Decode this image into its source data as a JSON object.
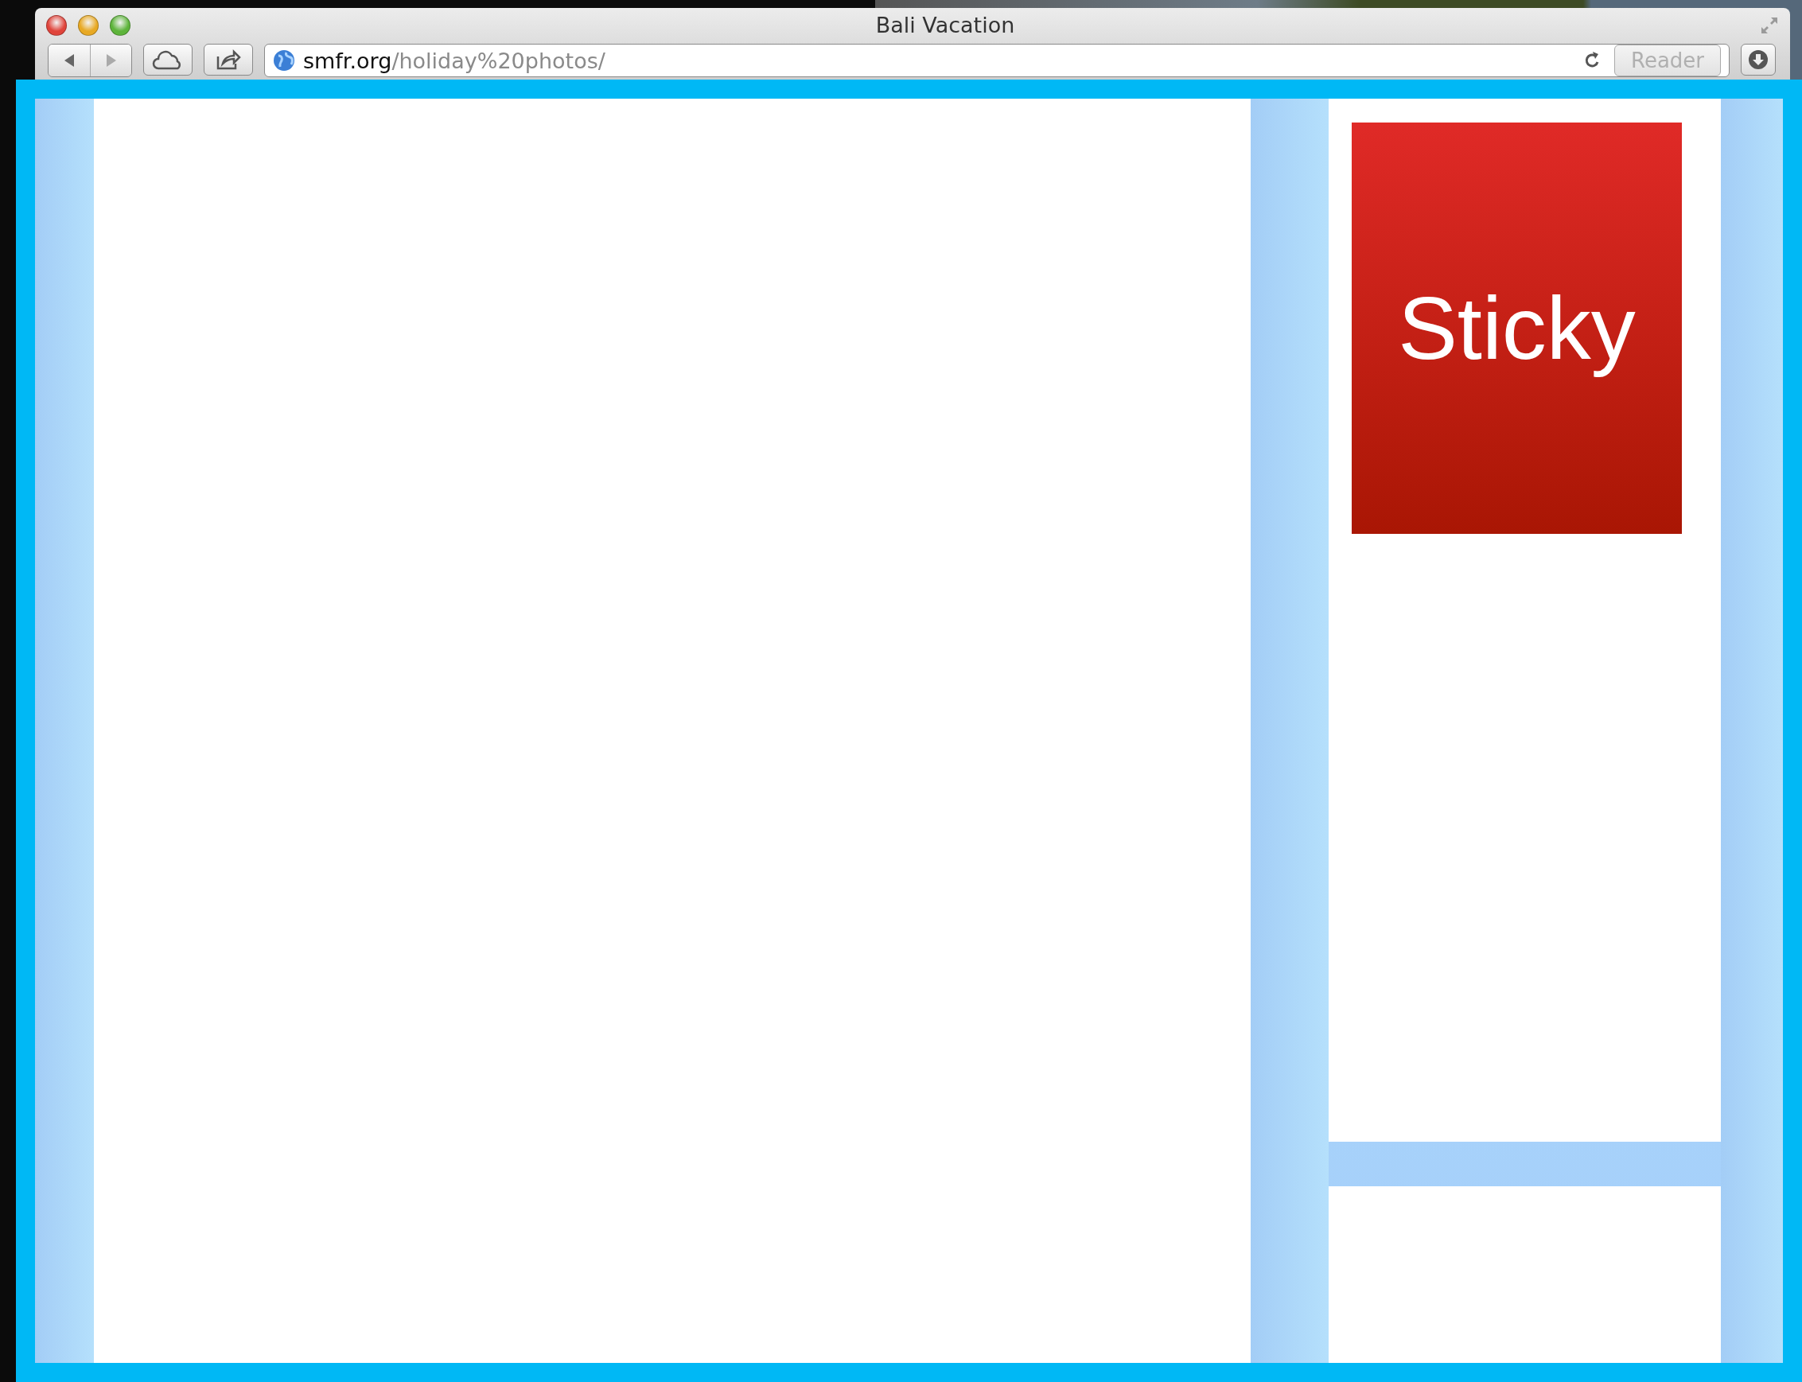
{
  "window": {
    "title": "Bali Vacation"
  },
  "toolbar": {
    "url_host": "smfr.org",
    "url_path": "/holiday%20photos/",
    "reader_label": "Reader"
  },
  "page": {
    "sticky_label": "Sticky"
  }
}
